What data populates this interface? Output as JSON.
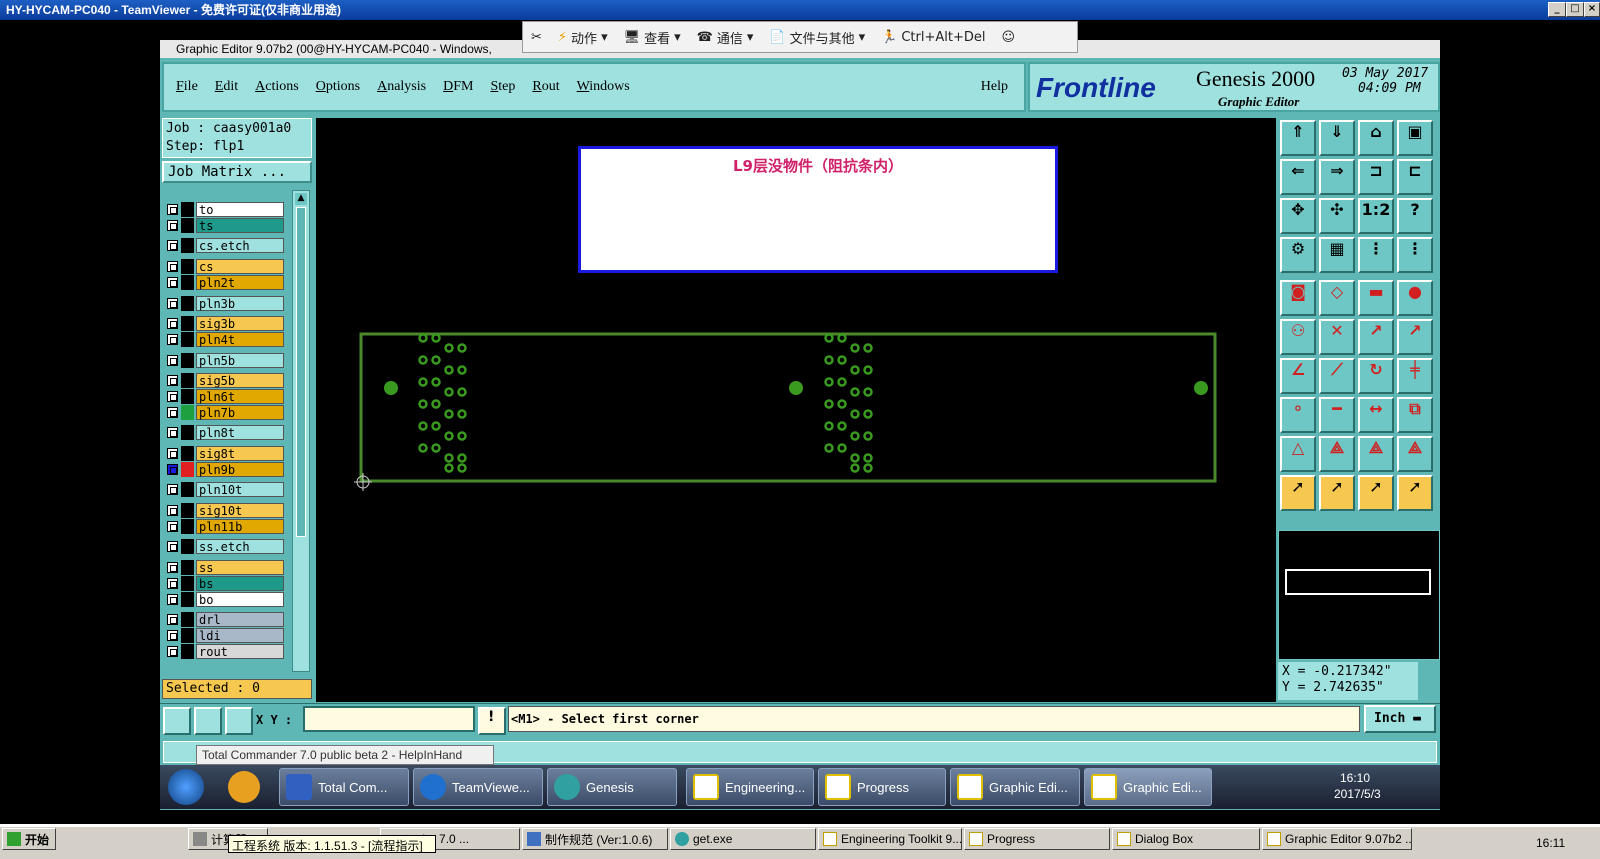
{
  "teamviewer": {
    "title": "HY-HYCAM-PC040 - TeamViewer - 免费许可证(仅非商业用途)",
    "toolbar": {
      "actions": "动作",
      "view": "查看",
      "comm": "通信",
      "files": "文件与其他",
      "cad": "Ctrl+Alt+Del"
    }
  },
  "graphic_editor": {
    "title": "Graphic Editor 9.07b2 (00@HY-HYCAM-PC040 - Windows,",
    "menu": [
      "File",
      "Edit",
      "Actions",
      "Options",
      "Analysis",
      "DFM",
      "Step",
      "Rout",
      "Windows"
    ],
    "help": "Help",
    "logo": {
      "brand": "Frontline",
      "product": "Genesis 2000",
      "subtitle": "Graphic Editor",
      "date": "03 May 2017",
      "time": "04:09 PM"
    },
    "job": {
      "job_line": "Job : caasy001a0",
      "step_line": "Step: flp1",
      "matrix_button": "Job Matrix ..."
    },
    "layers": [
      {
        "name": "to",
        "color": "#ffffff"
      },
      {
        "name": "ts",
        "color": "#1f9a8a"
      },
      {
        "name": "cs.etch",
        "color": "#9ee1df"
      },
      {
        "name": "cs",
        "color": "#f6c84f"
      },
      {
        "name": "pln2t",
        "color": "#e0a800"
      },
      {
        "name": "pln3b",
        "color": "#9ee1df"
      },
      {
        "name": "sig3b",
        "color": "#f6c84f"
      },
      {
        "name": "pln4t",
        "color": "#e0a800"
      },
      {
        "name": "pln5b",
        "color": "#9ee1df"
      },
      {
        "name": "sig5b",
        "color": "#f6c84f"
      },
      {
        "name": "pln6t",
        "color": "#e0a800"
      },
      {
        "name": "pln7b",
        "color": "#e0a800"
      },
      {
        "name": "pln8t",
        "color": "#9ee1df"
      },
      {
        "name": "sig8t",
        "color": "#f6c84f"
      },
      {
        "name": "pln9b",
        "color": "#e0a800"
      },
      {
        "name": "pln10t",
        "color": "#9ee1df"
      },
      {
        "name": "sig10t",
        "color": "#f6c84f"
      },
      {
        "name": "pln11b",
        "color": "#e0a800"
      },
      {
        "name": "ss.etch",
        "color": "#9ee1df"
      },
      {
        "name": "ss",
        "color": "#f6c84f"
      },
      {
        "name": "bs",
        "color": "#1f9a8a"
      },
      {
        "name": "bo",
        "color": "#ffffff"
      },
      {
        "name": "drl",
        "color": "#a8b8c8"
      },
      {
        "name": "ldi",
        "color": "#a8b8c8"
      },
      {
        "name": "rout",
        "color": "#d8d8d8"
      }
    ],
    "selected": "Selected : 0",
    "note": "L9层没物件（阻抗条内）",
    "coords": {
      "x": "X = -0.217342\"",
      "y": "Y = 2.742635\""
    },
    "xy_label": "X Y :",
    "prompt": "<M1> - Select first corner",
    "unit": "Inch",
    "tooltip": "Total Commander 7.0 public beta 2 - HelpInHand"
  },
  "win7_taskbar": {
    "items": [
      "Total Com...",
      "TeamViewe...",
      "Genesis",
      "Engineering...",
      "Progress",
      "Graphic Edi...",
      "Graphic Edi..."
    ],
    "time": "16:10",
    "date": "2017/5/3"
  },
  "xp_taskbar": {
    "start": "开始",
    "items": [
      "计算器",
      "mmander 7.0 ...",
      "制作规范 (Ver:1.0.6)",
      "get.exe",
      "Engineering Toolkit 9....",
      "Progress",
      "Dialog Box",
      "Graphic Editor 9.07b2 ..."
    ],
    "tooltip": "工程系统  版本: 1.1.51.3 - [流程指示]",
    "time": "16:11"
  }
}
